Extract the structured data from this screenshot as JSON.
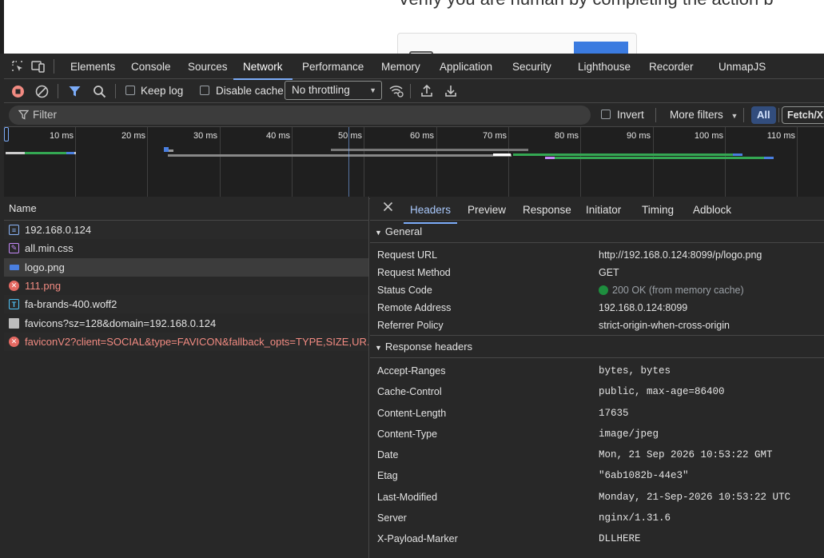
{
  "page": {
    "heading": "Verify you are human by completing the action b"
  },
  "devtools": {
    "tabs": [
      "Elements",
      "Console",
      "Sources",
      "Network",
      "Performance",
      "Memory",
      "Application",
      "Security",
      "Lighthouse",
      "Recorder",
      "UnmapJS"
    ],
    "active_tab": "Network",
    "toolbar": {
      "keep_log": "Keep log",
      "disable_cache": "Disable cache",
      "throttling": "No throttling"
    },
    "filter": {
      "placeholder": "Filter",
      "invert": "Invert",
      "more_filters": "More filters",
      "all": "All",
      "fetch": "Fetch/XH"
    },
    "overview": {
      "ticks": [
        "10 ms",
        "20 ms",
        "30 ms",
        "40 ms",
        "50 ms",
        "60 ms",
        "70 ms",
        "80 ms",
        "90 ms",
        "100 ms",
        "110 ms"
      ]
    },
    "requests": {
      "header": "Name",
      "items": [
        {
          "name": "192.168.0.124",
          "type": "doc",
          "error": false
        },
        {
          "name": "all.min.css",
          "type": "css",
          "error": false
        },
        {
          "name": "logo.png",
          "type": "img",
          "error": false,
          "selected": true
        },
        {
          "name": "111.png",
          "type": "err",
          "error": true
        },
        {
          "name": "fa-brands-400.woff2",
          "type": "font",
          "error": false
        },
        {
          "name": "favicons?sz=128&domain=192.168.0.124",
          "type": "file",
          "error": false
        },
        {
          "name": "faviconV2?client=SOCIAL&type=FAVICON&fallback_opts=TYPE,SIZE,UR...",
          "type": "err",
          "error": true
        }
      ]
    },
    "details": {
      "tabs": [
        "Headers",
        "Preview",
        "Response",
        "Initiator",
        "Timing",
        "Adblock"
      ],
      "active_tab": "Headers",
      "general": {
        "title": "General",
        "rows": [
          {
            "k": "Request URL",
            "v": "http://192.168.0.124:8099/p/logo.png"
          },
          {
            "k": "Request Method",
            "v": "GET"
          },
          {
            "k": "Status Code",
            "v": "200 OK (from memory cache)"
          },
          {
            "k": "Remote Address",
            "v": "192.168.0.124:8099"
          },
          {
            "k": "Referrer Policy",
            "v": "strict-origin-when-cross-origin"
          }
        ]
      },
      "response_headers": {
        "title": "Response headers",
        "rows": [
          {
            "k": "Accept-Ranges",
            "v": "bytes, bytes"
          },
          {
            "k": "Cache-Control",
            "v": "public, max-age=86400"
          },
          {
            "k": "Content-Length",
            "v": "17635"
          },
          {
            "k": "Content-Type",
            "v": "image/jpeg"
          },
          {
            "k": "Date",
            "v": "Mon, 21 Sep 2026 10:53:22 GMT"
          },
          {
            "k": "Etag",
            "v": "\"6ab1082b-44e3\""
          },
          {
            "k": "Last-Modified",
            "v": "Monday, 21-Sep-2026 10:53:22 UTC"
          },
          {
            "k": "Server",
            "v": "nginx/1.31.6"
          },
          {
            "k": "X-Payload-Marker",
            "v": "DLLHERE"
          }
        ]
      }
    }
  },
  "colors": {
    "accent": "#7cacf8",
    "error": "#f28b82",
    "status_ok": "#1e8e3e"
  }
}
